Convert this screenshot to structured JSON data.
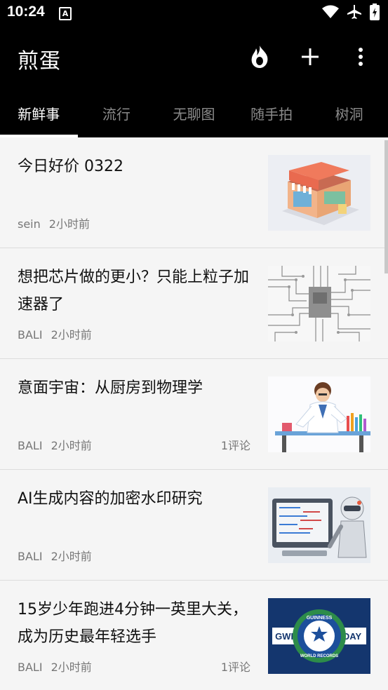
{
  "status_bar": {
    "time": "10:24",
    "notification_icon": "font-A-icon",
    "icons": [
      "wifi-icon",
      "airplane-icon",
      "battery-icon"
    ]
  },
  "app_bar": {
    "title": "煎蛋",
    "actions": [
      "hot-fire-icon",
      "add-icon",
      "more-vert-icon"
    ]
  },
  "tabs": [
    {
      "label": "新鲜事",
      "active": true
    },
    {
      "label": "流行",
      "active": false
    },
    {
      "label": "无聊图",
      "active": false
    },
    {
      "label": "随手拍",
      "active": false
    },
    {
      "label": "树洞",
      "active": false
    }
  ],
  "posts": [
    {
      "title": "今日好价 0322",
      "author": "sein",
      "time": "2小时前",
      "comments": ""
    },
    {
      "title": "想把芯片做的更小？只能上粒子加速器了",
      "author": "BALI",
      "time": "2小时前",
      "comments": ""
    },
    {
      "title": "意面宇宙：从厨房到物理学",
      "author": "BALI",
      "time": "2小时前",
      "comments": "1评论"
    },
    {
      "title": "AI生成内容的加密水印研究",
      "author": "BALI",
      "time": "2小时前",
      "comments": ""
    },
    {
      "title": "15岁少年跑进4分钟一英里大关，成为历史最年轻选手",
      "author": "BALI",
      "time": "2小时前",
      "comments": "1评论"
    }
  ],
  "thumbnail_text": {
    "gwr": "GWR",
    "day": "DAY",
    "guinness": "GUINNESS",
    "world_records": "WORLD RECORDS"
  },
  "colors": {
    "bar_bg": "#000000",
    "tab_active": "#ffffff",
    "tab_inactive": "#8a8a8a",
    "list_bg": "#f5f5f5"
  }
}
